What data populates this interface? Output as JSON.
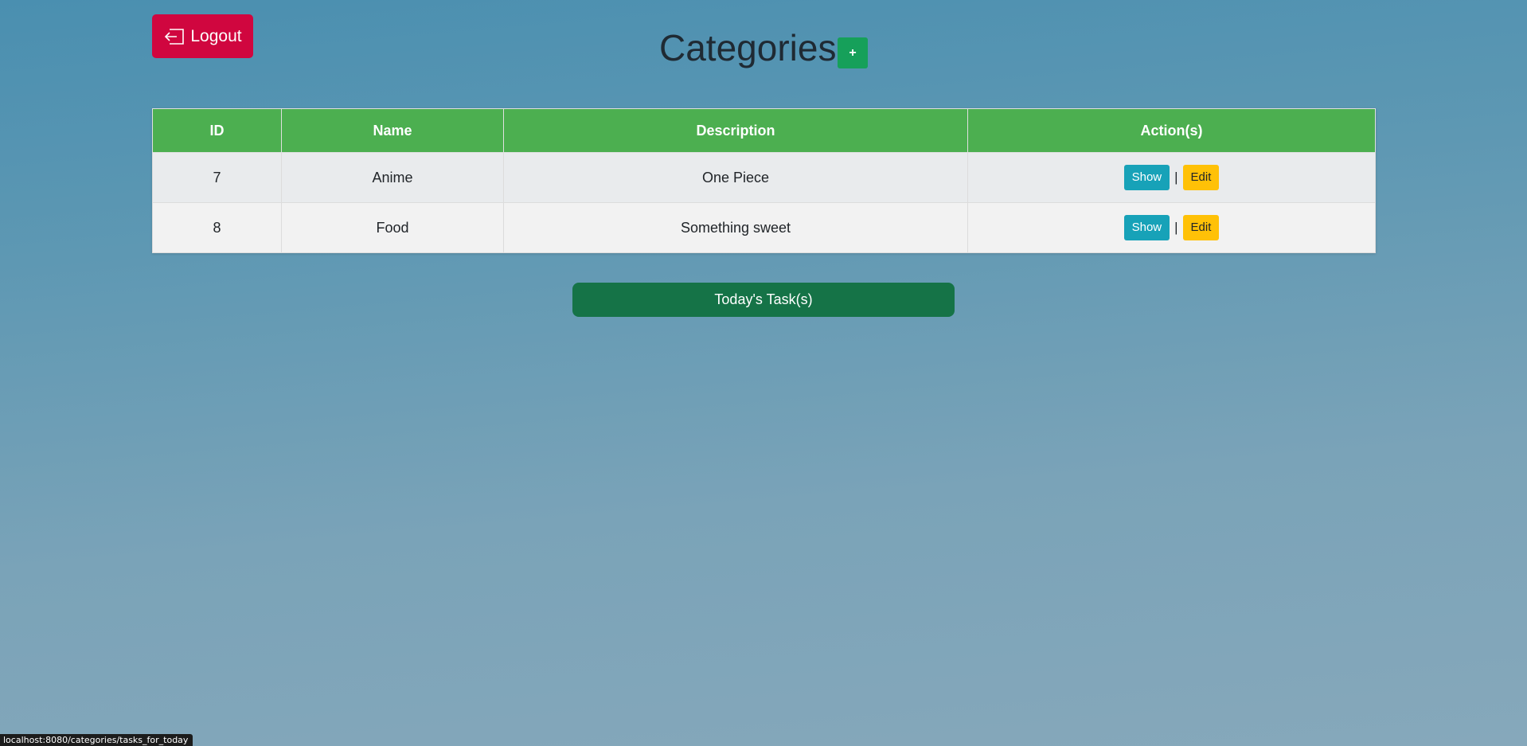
{
  "header": {
    "logout_label": "Logout",
    "title": "Categories",
    "add_label": "+"
  },
  "table": {
    "columns": [
      "ID",
      "Name",
      "Description",
      "Action(s)"
    ],
    "rows": [
      {
        "id": "7",
        "name": "Anime",
        "description": "One Piece",
        "show_label": "Show",
        "separator": "|",
        "edit_label": "Edit"
      },
      {
        "id": "8",
        "name": "Food",
        "description": "Something sweet",
        "show_label": "Show",
        "separator": "|",
        "edit_label": "Edit"
      }
    ]
  },
  "footer": {
    "today_tasks_label": "Today's Task(s)"
  },
  "status_bar": {
    "url": "localhost:8080/categories/tasks_for_today"
  },
  "colors": {
    "logout": "#d0063f",
    "add": "#16a05a",
    "table_header": "#4caf50",
    "show": "#17a2b8",
    "edit": "#ffc107",
    "today_tasks": "#157347"
  },
  "icons": {
    "logout": "logout-icon"
  }
}
